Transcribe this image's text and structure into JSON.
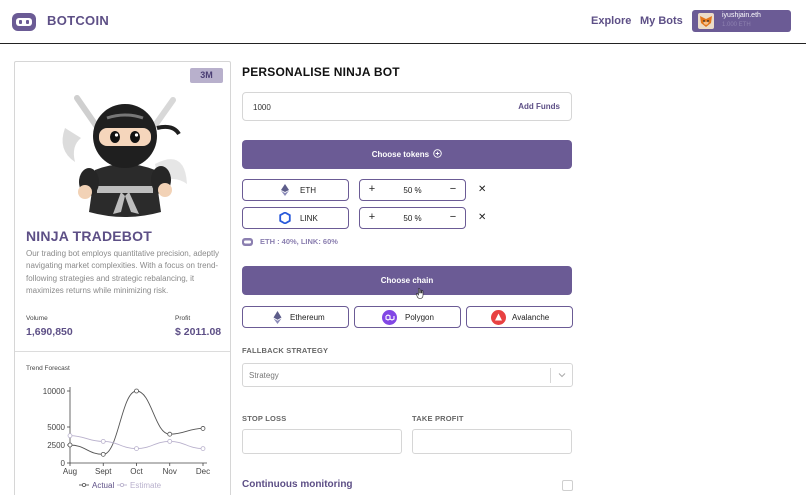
{
  "header": {
    "brand": "BOTCOIN",
    "nav": {
      "explore": "Explore",
      "my_bots": "My Bots"
    },
    "wallet": {
      "name": "iyushjain.eth",
      "balance": "1.000 ETH"
    }
  },
  "bot_card": {
    "badge": "3M",
    "title": "NINJA TRADEBOT",
    "description": "Our trading bot employs quantitative precision, adeptly navigating market complexities. With a focus on trend-following strategies and strategic rebalancing, it maximizes returns while minimizing risk.",
    "volume_label": "Volume",
    "volume_value": "1,690,850",
    "profit_label": "Profit",
    "profit_value": "$ 2011.08",
    "trend_title": "Trend Forecast"
  },
  "chart_data": {
    "type": "line",
    "title": "Trend Forecast",
    "categories": [
      "Aug",
      "Sept",
      "Oct",
      "Nov",
      "Dec"
    ],
    "series": [
      {
        "name": "Actual",
        "values": [
          2500,
          1200,
          10000,
          4000,
          4800
        ]
      },
      {
        "name": "Estimate",
        "values": [
          3800,
          3000,
          2000,
          3000,
          2000
        ]
      }
    ],
    "yticks": [
      0,
      2500,
      5000,
      10000
    ],
    "ylim": [
      0,
      10000
    ],
    "legend": "bottom",
    "colors": {
      "actual": "#555555",
      "estimate": "#b8b0cc"
    }
  },
  "config": {
    "title": "PERSONALISE NINJA BOT",
    "amount_value": "1000",
    "add_funds": "Add Funds",
    "choose_tokens": "Choose tokens",
    "tokens": [
      {
        "name": "ETH",
        "percent": "50 %"
      },
      {
        "name": "LINK",
        "percent": "50 %"
      }
    ],
    "plus": "+",
    "minus": "−",
    "remove": "✕",
    "allocation_summary": "ETH : 40%, LINK: 60%",
    "choose_chain": "Choose chain",
    "chains": [
      "Ethereum",
      "Polygon",
      "Avalanche"
    ],
    "fallback_label": "FALLBACK STRATEGY",
    "fallback_placeholder": "Strategy",
    "stop_loss_label": "STOP LOSS",
    "take_profit_label": "TAKE PROFIT",
    "continuous_label": "Continuous monitoring"
  },
  "colors": {
    "accent": "#6b5b95",
    "brand_text": "#5d4f86",
    "badge_bg": "#b8b0cc"
  }
}
